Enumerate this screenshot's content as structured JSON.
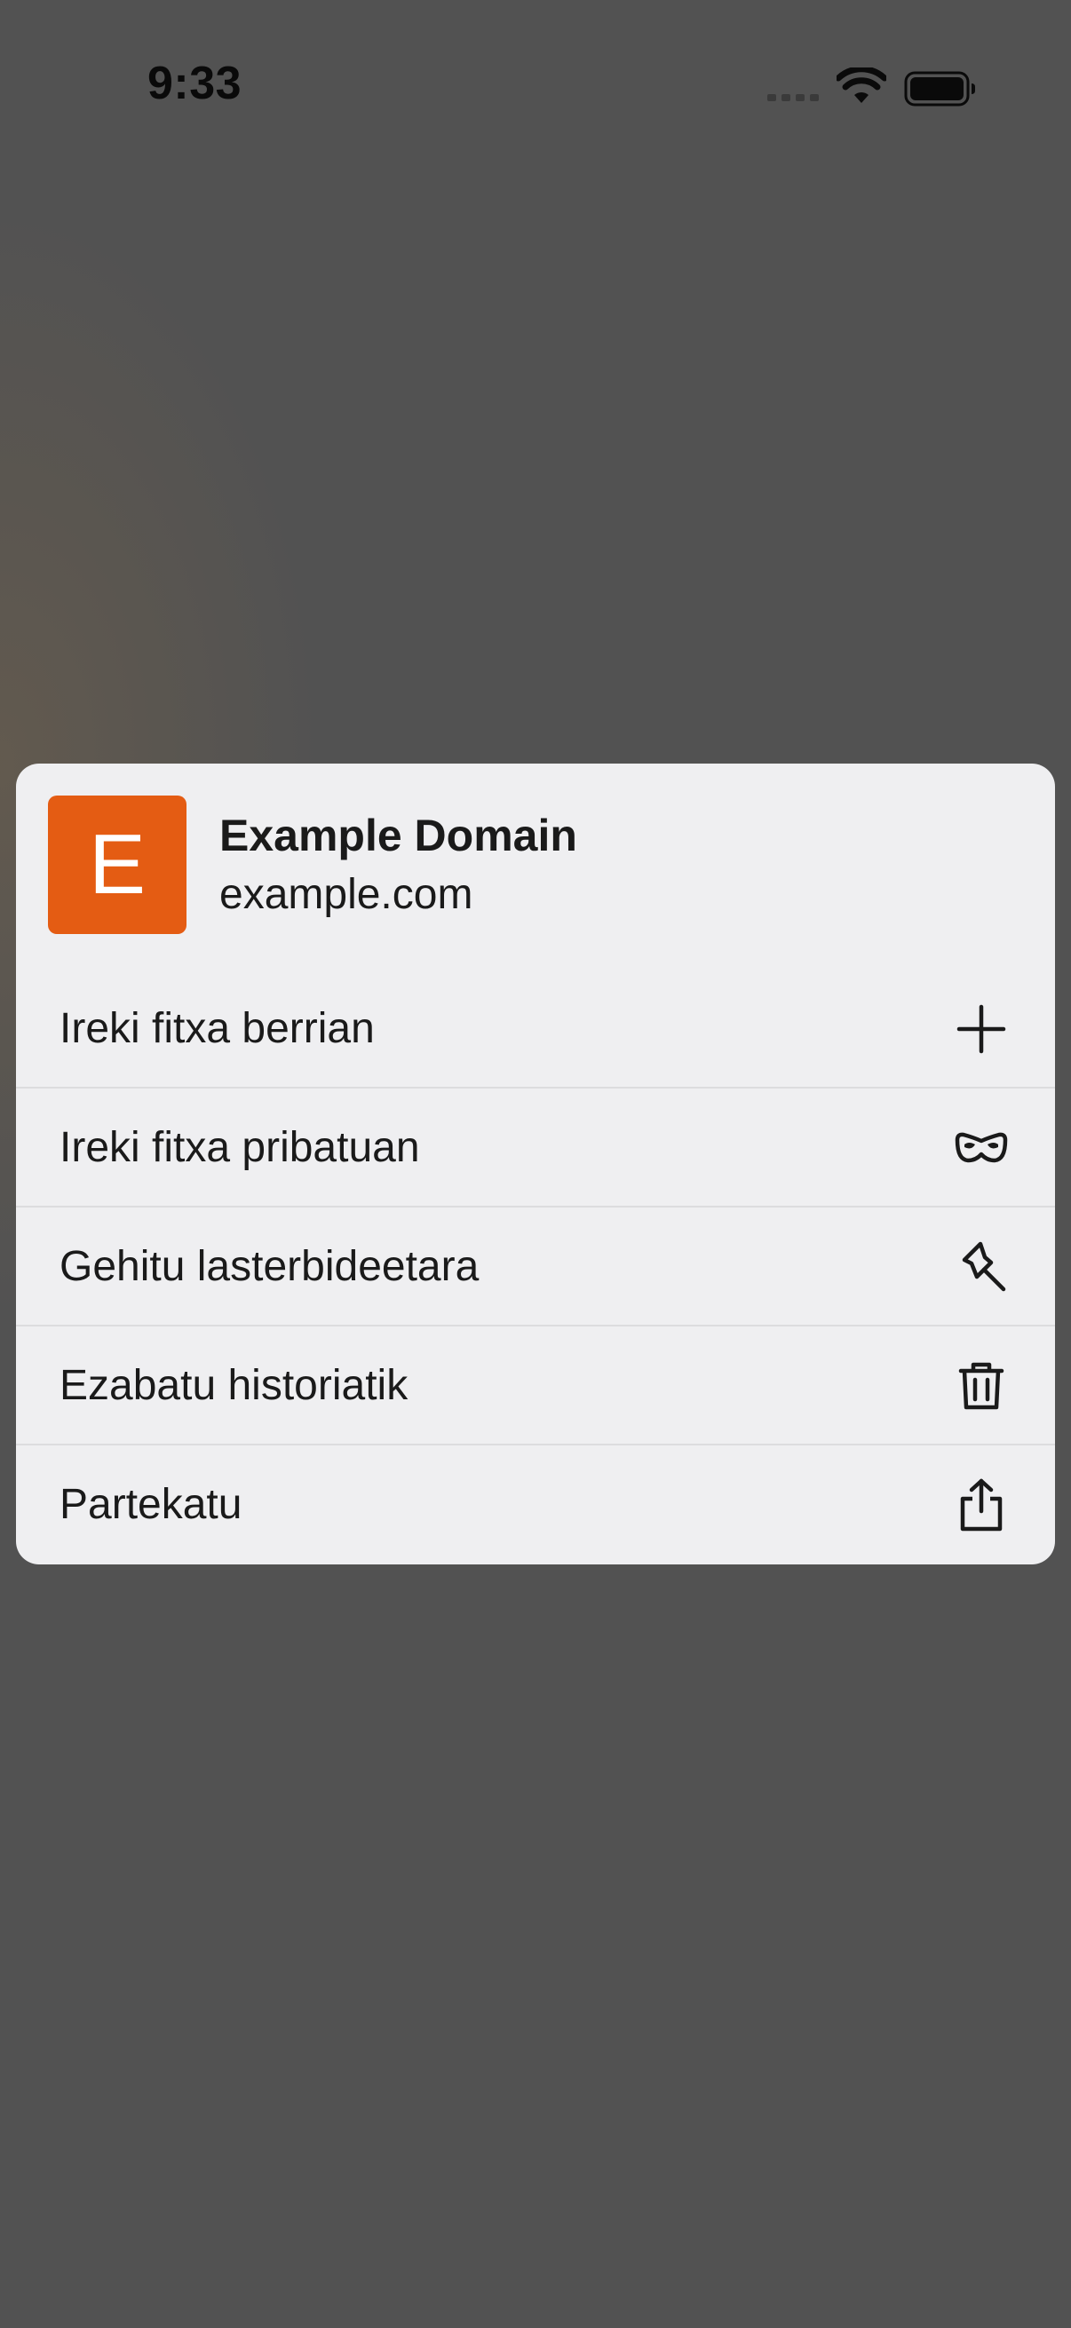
{
  "status_bar": {
    "time": "9:33",
    "icons": [
      "cellular-signal-icon",
      "wifi-icon",
      "battery-icon"
    ]
  },
  "site": {
    "favicon_letter": "E",
    "favicon_color": "#e45c13",
    "title": "Example Domain",
    "url": "example.com"
  },
  "menu": {
    "items": [
      {
        "label": "Ireki fitxa berrian",
        "icon": "plus-icon"
      },
      {
        "label": "Ireki fitxa pribatuan",
        "icon": "private-mask-icon"
      },
      {
        "label": "Gehitu lasterbideetara",
        "icon": "pin-icon"
      },
      {
        "label": "Ezabatu historiatik",
        "icon": "trash-icon"
      },
      {
        "label": "Partekatu",
        "icon": "share-icon"
      }
    ]
  }
}
